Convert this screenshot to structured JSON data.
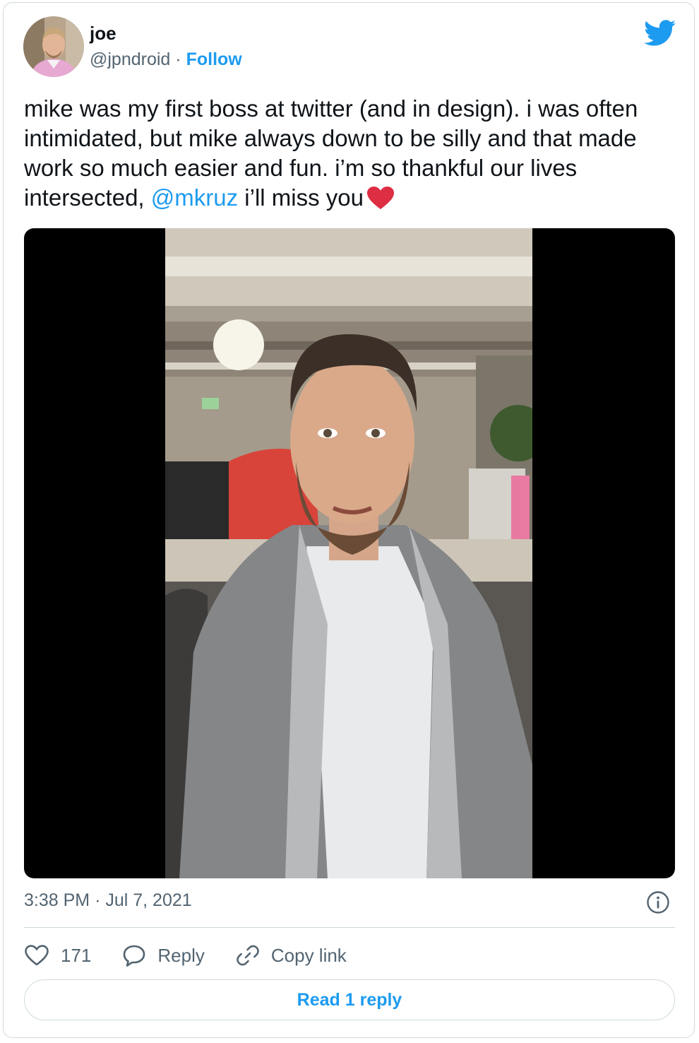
{
  "author": {
    "name": "joe",
    "handle": "@jpndroid",
    "separator": "·",
    "follow_label": "Follow"
  },
  "icons": {
    "brand": "twitter-bird-icon",
    "info": "info-icon",
    "like": "heart-outline-icon",
    "reply": "speech-bubble-icon",
    "copy": "link-icon"
  },
  "tweet": {
    "text_before_mention": "mike was my first boss at twitter (and in design). i was often intimidated, but mike always down to be silly and that made work so much easier and fun. i’m so thankful our lives intersected, ",
    "mention": "@mkruz",
    "text_after_mention": " i’ll miss you",
    "emoji": "red-heart-emoji"
  },
  "meta": {
    "time": "3:38 PM",
    "separator": "·",
    "date": "Jul 7, 2021"
  },
  "actions": {
    "like_count": "171",
    "reply_label": "Reply",
    "copy_label": "Copy link"
  },
  "read_reply_label": "Read 1 reply",
  "colors": {
    "accent": "#1d9bf0",
    "text": "#0f1419",
    "secondary": "#536471",
    "border": "#cfd9de",
    "heart": "#e0245e"
  }
}
